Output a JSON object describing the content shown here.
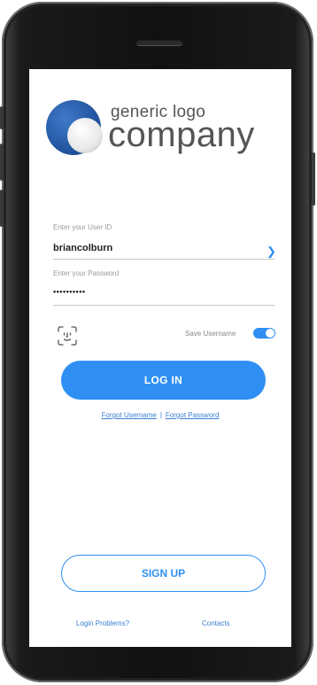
{
  "logo": {
    "tagline": "generic logo",
    "name": "company"
  },
  "form": {
    "user_id_label": "Enter your User ID",
    "user_id_value": "briancolburn",
    "password_label": "Enter your Password",
    "password_value": "••••••••••"
  },
  "options": {
    "save_username_label": "Save Username",
    "save_username_on": true
  },
  "actions": {
    "login_label": "LOG IN",
    "forgot_username": "Forgot Username",
    "separator": "|",
    "forgot_password": "Forgot Password",
    "signup_label": "SIGN UP",
    "login_problems": "Login Problems?",
    "contacts": "Contacts"
  },
  "colors": {
    "accent": "#2f8ff3",
    "logo_blue": "#1e4f9a",
    "text_gray": "#555555"
  },
  "icons": [
    "chevron-right-icon",
    "face-id-icon",
    "toggle-switch"
  ]
}
